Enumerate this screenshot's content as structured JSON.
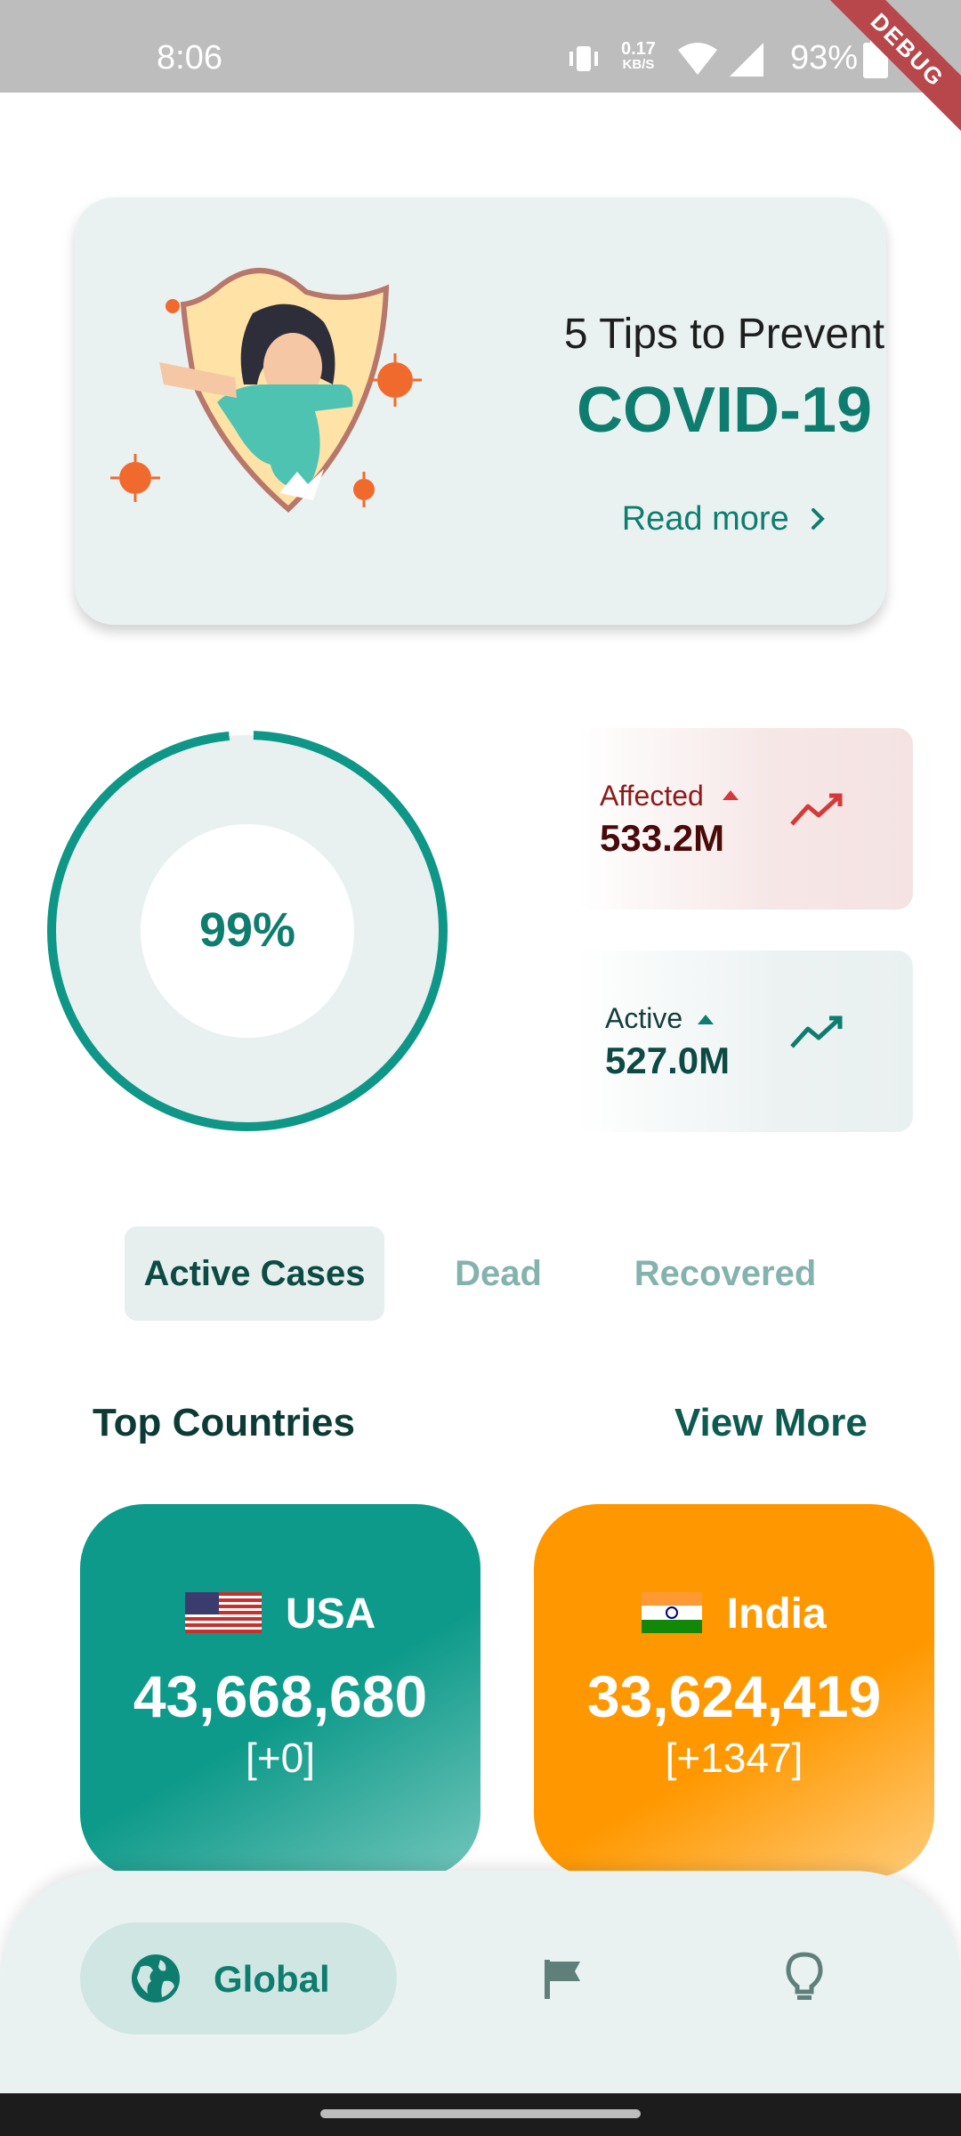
{
  "status_bar": {
    "time": "8:06",
    "net_speed_value": "0.17",
    "net_speed_unit": "KB/S",
    "battery": "93%",
    "debug_label": "DEBUG"
  },
  "tips_card": {
    "title": "5 Tips to Prevent",
    "highlight": "COVID-19",
    "link": "Read more",
    "link_icon": "chevron-right-icon"
  },
  "summary": {
    "percent": "99%",
    "percent_value": 0.99,
    "affected": {
      "label": "Affected",
      "value": "533.2M",
      "trend_icon": "trend-up-icon"
    },
    "active": {
      "label": "Active",
      "value": "527.0M",
      "trend_icon": "trend-up-icon"
    }
  },
  "tabs": [
    {
      "label": "Active Cases",
      "selected": true
    },
    {
      "label": "Dead",
      "selected": false
    },
    {
      "label": "Recovered",
      "selected": false
    }
  ],
  "top_countries": {
    "title": "Top Countries",
    "view_more": "View More",
    "countries": [
      {
        "name": "USA",
        "count": "43,668,680",
        "delta": "[+0]",
        "flag_icon": "usa-flag-icon"
      },
      {
        "name": "India",
        "count": "33,624,419",
        "delta": "[+1347]",
        "flag_icon": "india-flag-icon"
      }
    ]
  },
  "bottom_nav": {
    "items": [
      {
        "label": "Global",
        "icon": "globe-icon",
        "selected": true
      },
      {
        "label": "",
        "icon": "flag-icon",
        "selected": false
      },
      {
        "label": "",
        "icon": "lightbulb-icon",
        "selected": false
      }
    ]
  },
  "colors": {
    "primary": "#0e7d6f",
    "accent_orange": "#ff9800",
    "danger": "#d43a3a",
    "card_bg": "#eaf2f1"
  }
}
